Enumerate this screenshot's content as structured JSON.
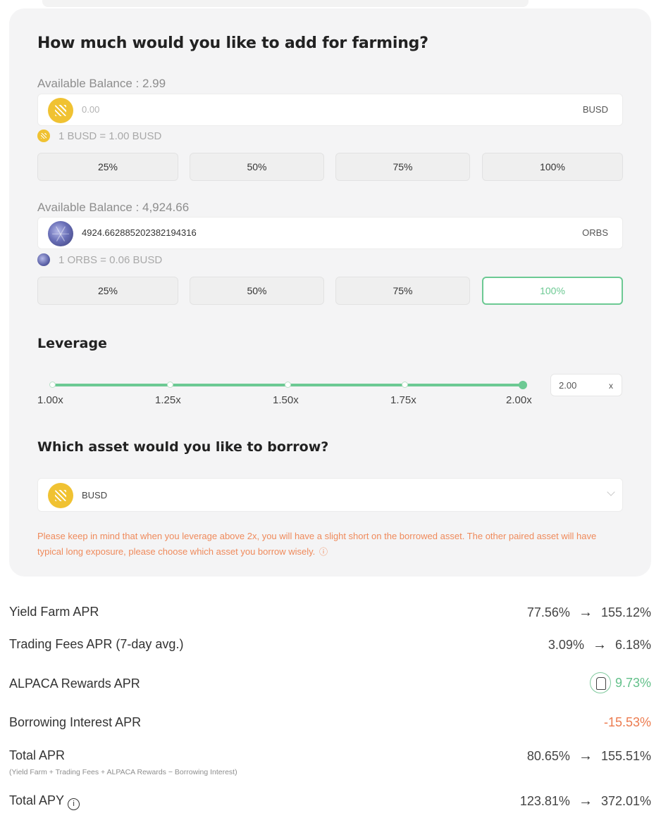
{
  "form": {
    "title": "How much would you like to add for farming?",
    "token_a": {
      "balance_label": "Available Balance : 2.99",
      "value": "0.00",
      "symbol": "BUSD",
      "rate": "1 BUSD = 1.00 BUSD",
      "icon": "busd-coin-icon"
    },
    "token_b": {
      "balance_label": "Available Balance : 4,924.66",
      "value": "4924.662885202382194316",
      "symbol": "ORBS",
      "rate": "1 ORBS = 0.06 BUSD",
      "icon": "orbs-coin-icon"
    },
    "percent_buttons": [
      "25%",
      "50%",
      "75%",
      "100%"
    ],
    "token_b_selected_percent": "100%"
  },
  "leverage": {
    "title": "Leverage",
    "ticks": [
      "1.00x",
      "1.25x",
      "1.50x",
      "1.75x",
      "2.00x"
    ],
    "value": "2.00",
    "suffix": "x",
    "slider_fraction": 1.0
  },
  "borrow": {
    "title": "Which asset would you like to borrow?",
    "selected": "BUSD",
    "warning": "Please keep in mind that when you leverage above 2x, you will have a slight short on the borrowed asset. The other paired asset will have typical long exposure, please choose which asset you borrow wisely.",
    "warning_icon": "ⓘ"
  },
  "stats": {
    "yield_farm": {
      "label": "Yield Farm APR",
      "from": "77.56%",
      "to": "155.12%"
    },
    "trading_fees": {
      "label": "Trading Fees APR (7-day avg.)",
      "from": "3.09%",
      "to": "6.18%"
    },
    "alpaca_rewards": {
      "label": "ALPACA Rewards APR",
      "value": "9.73%"
    },
    "borrowing_interest": {
      "label": "Borrowing Interest APR",
      "value": "-15.53%"
    },
    "total_apr": {
      "label": "Total APR",
      "sub": "(Yield Farm + Trading Fees + ALPACA Rewards − Borrowing Interest)",
      "from": "80.65%",
      "to": "155.51%"
    },
    "total_apy": {
      "label": "Total APY",
      "from": "123.81%",
      "to": "372.01%"
    }
  },
  "colors": {
    "accent_green": "#6cc993",
    "warning_orange": "#ef8a5b",
    "busd_yellow": "#f0c232"
  }
}
